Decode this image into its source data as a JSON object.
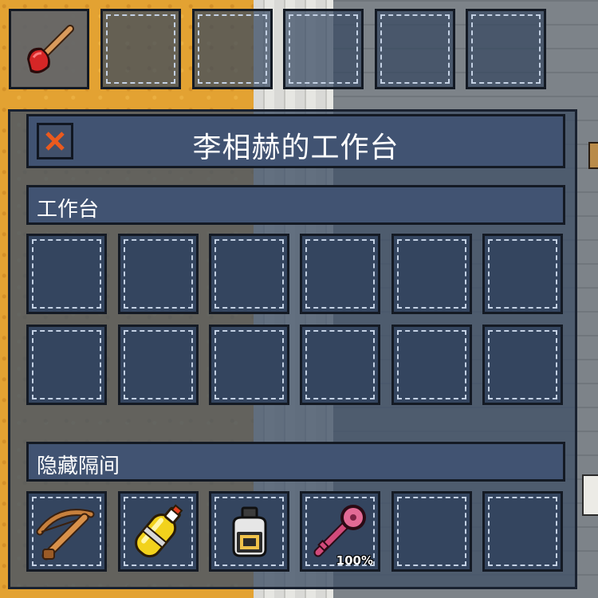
{
  "hotbar": {
    "slots": [
      {
        "item": "plunger",
        "icon": "plunger-icon"
      },
      {
        "item": null
      },
      {
        "item": null
      },
      {
        "item": null
      },
      {
        "item": null
      },
      {
        "item": null
      }
    ]
  },
  "panel": {
    "title": "李相赫的工作台",
    "close_icon": "close-icon",
    "workbench": {
      "label": "工作台",
      "rows": 2,
      "columns": 6,
      "slots_filled": 0
    },
    "hidden_compartment": {
      "label": "隐藏隔间",
      "slots": [
        {
          "item": "crossbow",
          "icon": "crossbow-icon"
        },
        {
          "item": "gas-canister",
          "icon": "gas-canister-icon"
        },
        {
          "item": "ink-bottle",
          "icon": "ink-bottle-icon"
        },
        {
          "item": "key",
          "icon": "key-icon",
          "durability": "100%"
        },
        {
          "item": null
        },
        {
          "item": null
        }
      ]
    }
  },
  "colors": {
    "panel_bg": "#425268",
    "slot_bg": "#34455f",
    "close_x": "#ea5a1e",
    "sand": "#e3a232"
  }
}
